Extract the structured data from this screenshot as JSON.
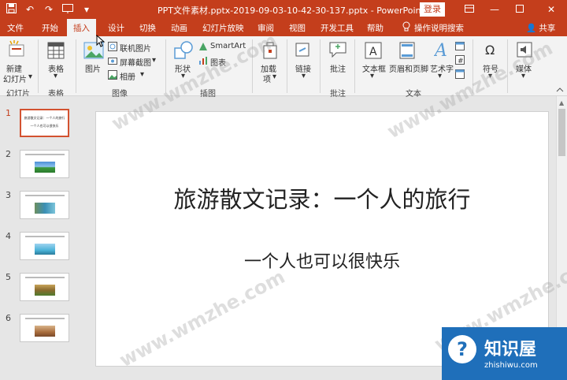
{
  "titlebar": {
    "title": "PPT文件素材.pptx-2019-09-03-10-42-30-137.pptx - PowerPoint",
    "login_label": "登录",
    "qat_icons": [
      "save-icon",
      "undo-icon",
      "redo-icon",
      "from-beginning-icon",
      "customize-icon"
    ],
    "window_controls": [
      "ribbon-display-icon",
      "minimize-icon",
      "maximize-icon",
      "close-icon"
    ]
  },
  "tabs": [
    {
      "label": "文件"
    },
    {
      "label": "开始"
    },
    {
      "label": "插入",
      "active": true
    },
    {
      "label": "设计"
    },
    {
      "label": "切换"
    },
    {
      "label": "动画"
    },
    {
      "label": "幻灯片放映"
    },
    {
      "label": "审阅"
    },
    {
      "label": "视图"
    },
    {
      "label": "开发工具"
    },
    {
      "label": "帮助"
    }
  ],
  "tell_me": "操作说明搜索",
  "share": "共享",
  "ribbon": {
    "new_slide_1": "新建",
    "new_slide_2": "幻灯片",
    "table": "表格",
    "picture": "图片",
    "online_picture": "联机图片",
    "screenshot": "屏幕截图",
    "album": "相册",
    "shapes": "形状",
    "smartart": "SmartArt",
    "chart": "图表",
    "addins_1": "加载",
    "addins_2": "项",
    "link": "链接",
    "comment": "批注",
    "textbox": "文本框",
    "header_footer": "页眉和页脚",
    "wordart": "艺术字",
    "symbols": "符号",
    "media": "媒体",
    "groups": {
      "slides": "幻灯片",
      "tables": "表格",
      "images": "图像",
      "illustrations": "插图",
      "comments": "批注",
      "text": "文本"
    }
  },
  "slides": [
    {
      "num": "1",
      "title": "旅游散文记录：一个人的旅行",
      "subtitle": "一个人也可以很快乐"
    },
    {
      "num": "2"
    },
    {
      "num": "3"
    },
    {
      "num": "4"
    },
    {
      "num": "5"
    },
    {
      "num": "6"
    }
  ],
  "current_slide": {
    "title": "旅游散文记录：一个人的旅行",
    "subtitle": "一个人也可以很快乐"
  },
  "watermark": "www.wmzhe.com",
  "logo": {
    "name": "知识屋",
    "url": "zhishiwu.com",
    "icon": "question-bubble-icon"
  },
  "colors": {
    "accent": "#c43e1c",
    "thumb_selected": "#d35230",
    "logo_bg": "#1f6fba"
  }
}
